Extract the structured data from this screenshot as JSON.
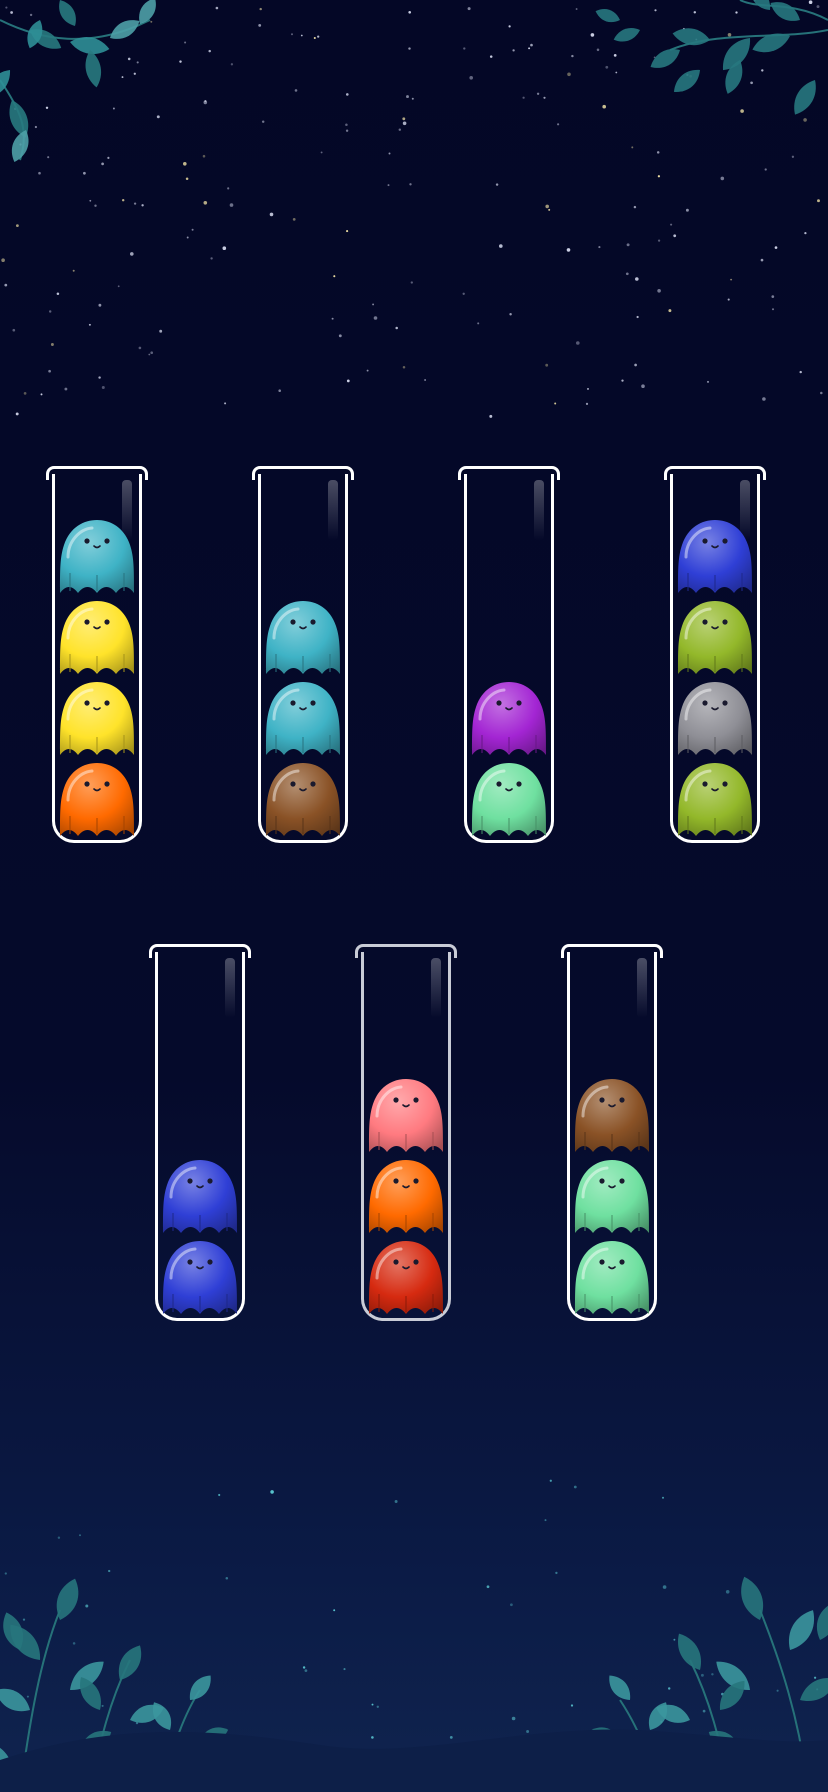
{
  "game": {
    "name": "ghost-sort-puzzle",
    "capacity": 4,
    "colors": {
      "teal": "#3fb3c6",
      "yellow": "#ffe32a",
      "orange": "#ff6a00",
      "brown": "#8a5226",
      "purple": "#a325d3",
      "mint": "#6fe0a0",
      "blue": "#2f3fd6",
      "olive": "#93b82a",
      "gray": "#8f8f96",
      "pink": "#ff7a80",
      "red": "#d62a10"
    },
    "tubes": [
      {
        "id": "tube-1",
        "selected": false,
        "ghosts_bottom_to_top": [
          "orange",
          "yellow",
          "yellow",
          "teal"
        ]
      },
      {
        "id": "tube-2",
        "selected": false,
        "ghosts_bottom_to_top": [
          "brown",
          "teal",
          "teal"
        ]
      },
      {
        "id": "tube-3",
        "selected": false,
        "ghosts_bottom_to_top": [
          "mint",
          "purple"
        ]
      },
      {
        "id": "tube-4",
        "selected": false,
        "ghosts_bottom_to_top": [
          "olive",
          "gray",
          "olive",
          "blue"
        ]
      },
      {
        "id": "tube-5",
        "selected": false,
        "ghosts_bottom_to_top": [
          "blue",
          "blue"
        ]
      },
      {
        "id": "tube-6",
        "selected": true,
        "ghosts_bottom_to_top": [
          "red",
          "orange",
          "pink"
        ]
      },
      {
        "id": "tube-7",
        "selected": false,
        "ghosts_bottom_to_top": [
          "mint",
          "mint",
          "brown"
        ]
      }
    ]
  },
  "theme": {
    "background_top": "#040726",
    "background_bottom": "#10244f",
    "tube_outline": "#ffffff",
    "tube_selected_outline": "#c9ccd6",
    "foliage": "#2f8f97"
  },
  "decorations": {
    "top_left": "leaf-branch",
    "top_right": "leaf-branch",
    "bottom_left": "leaf-bush",
    "bottom_right": "leaf-bush",
    "sky": "starfield"
  }
}
